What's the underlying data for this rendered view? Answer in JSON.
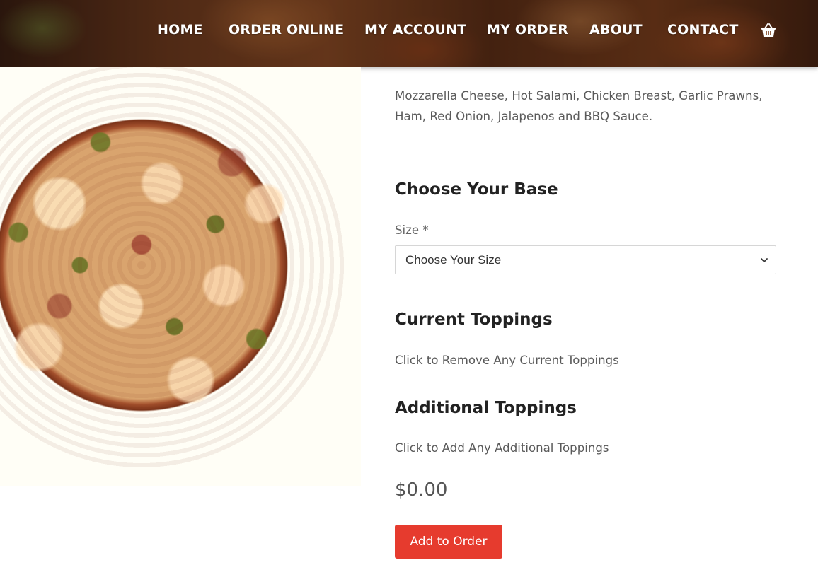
{
  "nav": {
    "items": [
      {
        "label": "HOME"
      },
      {
        "label": "ORDER ONLINE"
      },
      {
        "label": "MY ACCOUNT"
      },
      {
        "label": "MY ORDER"
      },
      {
        "label": "ABOUT"
      },
      {
        "label": "CONTACT"
      }
    ],
    "cart_icon": "shopping-basket-icon"
  },
  "product": {
    "description": "Mozzarella Cheese, Hot Salami, Chicken Breast, Garlic Prawns, Ham, Red Onion, Jalapenos and BBQ Sauce.",
    "base": {
      "title": "Choose Your Base",
      "size_label": "Size *",
      "size_selected": "Choose Your Size"
    },
    "current_toppings": {
      "title": "Current Toppings",
      "hint": "Click to Remove Any Current Toppings"
    },
    "additional_toppings": {
      "title": "Additional Toppings",
      "hint": "Click to Add Any Additional Toppings"
    },
    "price": "$0.00",
    "add_button_label": "Add to Order"
  },
  "colors": {
    "accent": "#e63b2e",
    "heading": "#222222",
    "body_text": "#5a5a5a"
  }
}
